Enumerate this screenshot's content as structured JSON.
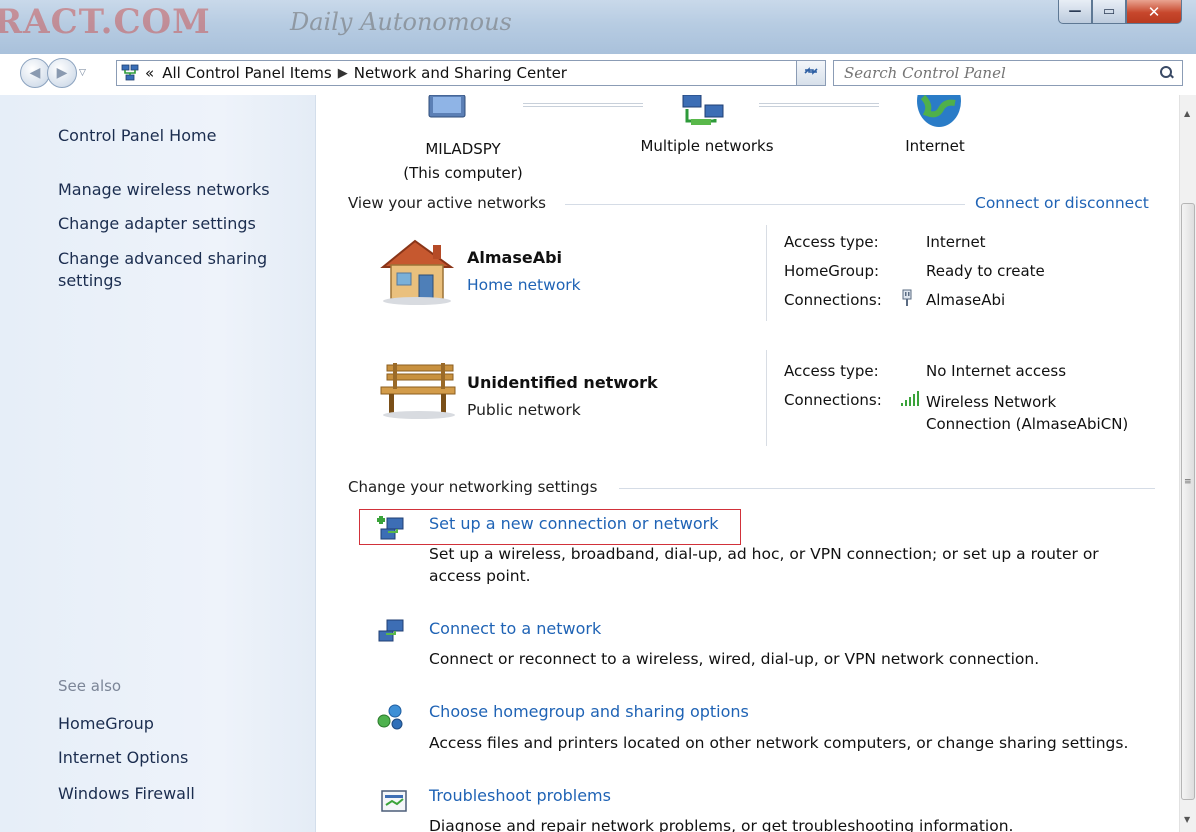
{
  "watermark": {
    "brand": "RACT.COM",
    "tagline": "Daily Autonomous"
  },
  "window_buttons": {
    "minimize": "—",
    "maximize": "▭",
    "close": "✕"
  },
  "address_bar": {
    "overflow": "«",
    "crumbs": [
      "All Control Panel Items",
      "Network and Sharing Center"
    ],
    "separator": "▶"
  },
  "search": {
    "placeholder": "Search Control Panel"
  },
  "left_pane": {
    "links": [
      "Control Panel Home",
      "Manage wireless networks",
      "Change adapter settings",
      "Change advanced sharing settings"
    ],
    "see_also_label": "See also",
    "see_also": [
      "HomeGroup",
      "Internet Options",
      "Windows Firewall"
    ]
  },
  "network_map": {
    "computer_name": "MILADSPY",
    "computer_sub": "(This computer)",
    "middle": "Multiple networks",
    "internet": "Internet"
  },
  "active_networks": {
    "heading": "View your active networks",
    "action_link": "Connect or disconnect",
    "networks": [
      {
        "name": "AlmaseAbi",
        "type": "Home network",
        "type_is_link": true,
        "props": [
          {
            "label": "Access type:",
            "value": "Internet",
            "link": false
          },
          {
            "label": "HomeGroup:",
            "value": "Ready to create",
            "link": true
          },
          {
            "label": "Connections:",
            "value": "AlmaseAbi",
            "link": true
          }
        ]
      },
      {
        "name": "Unidentified network",
        "type": "Public network",
        "type_is_link": false,
        "props": [
          {
            "label": "Access type:",
            "value": "No Internet access",
            "link": false
          },
          {
            "label": "Connections:",
            "value": "Wireless Network Connection (AlmaseAbiCN)",
            "value_line1": "Wireless Network",
            "value_line2": "Connection (AlmaseAbiCN)",
            "link": true
          }
        ]
      }
    ]
  },
  "networking_settings": {
    "heading": "Change your networking settings",
    "tasks": [
      {
        "title": "Set up a new connection or network",
        "desc_line1": "Set up a wireless, broadband, dial-up, ad hoc, or VPN connection; or set up a router or",
        "desc_line2": "access point.",
        "highlighted": true
      },
      {
        "title": "Connect to a network",
        "desc_line1": "Connect or reconnect to a wireless, wired, dial-up, or VPN network connection.",
        "desc_line2": "",
        "highlighted": false
      },
      {
        "title": "Choose homegroup and sharing options",
        "desc_line1": "Access files and printers located on other network computers, or change sharing settings.",
        "desc_line2": "",
        "highlighted": false
      },
      {
        "title": "Troubleshoot problems",
        "desc_line1": "Diagnose and repair network problems, or get troubleshooting information.",
        "desc_line2": "",
        "highlighted": false
      }
    ]
  },
  "colors": {
    "link": "#1f63b5",
    "highlight": "#d1313a",
    "pane": "#eef3fa"
  },
  "icons": [
    "network-icon",
    "refresh-icon",
    "search-icon",
    "computer-icon",
    "network-hub-icon",
    "globe-icon",
    "house-icon",
    "bench-icon",
    "ethernet-plug-icon",
    "wifi-signal-icon",
    "new-connection-icon",
    "connect-network-icon",
    "homegroup-icon",
    "troubleshoot-icon"
  ]
}
